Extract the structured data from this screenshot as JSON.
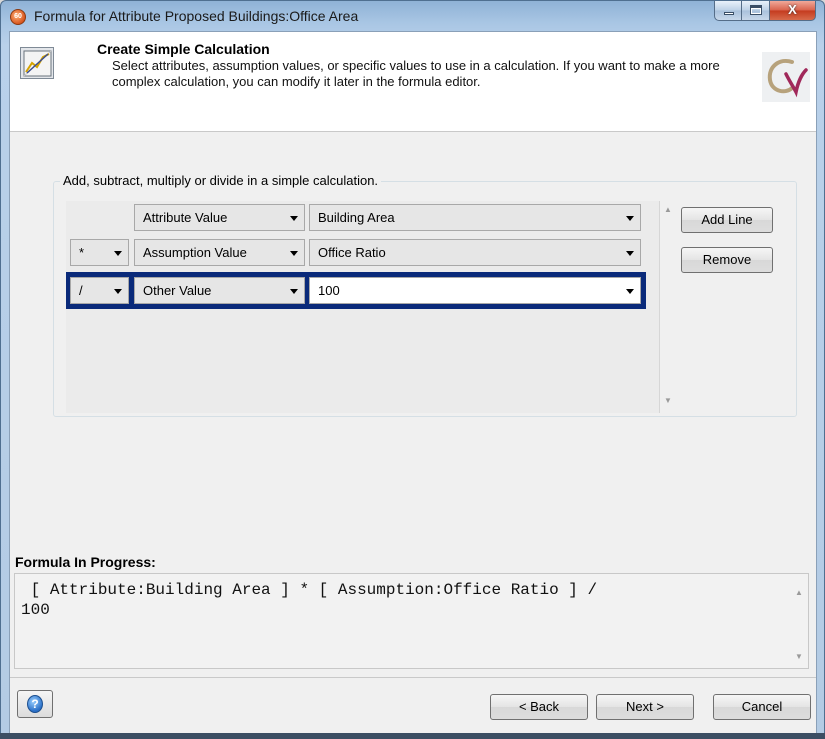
{
  "window": {
    "title": "Formula for Attribute Proposed Buildings:Office Area",
    "icon": "app-icon",
    "icon_text": "60",
    "caption": {
      "minimize": "minimize-icon",
      "maximize": "maximize-icon",
      "close_glyph": "X"
    }
  },
  "header": {
    "title": "Create Simple Calculation",
    "description": "Select attributes, assumption values, or specific values to use in a calculation.  If you want to make a more complex calculation, you can modify it later in the formula editor.",
    "icon": "chart-icon",
    "logo": "cv-logo"
  },
  "calc_group": {
    "label": "Add, subtract, multiply or divide in a simple calculation.",
    "rows": [
      {
        "operator": "",
        "type": "Attribute Value",
        "value": "Building Area",
        "selected": false
      },
      {
        "operator": "*",
        "type": "Assumption Value",
        "value": "Office Ratio",
        "selected": false
      },
      {
        "operator": "/",
        "type": "Other Value",
        "value": "100",
        "selected": true
      }
    ],
    "add_line_label": "Add Line",
    "remove_label": "Remove"
  },
  "formula": {
    "label": "Formula In Progress:",
    "text": " [ Attribute:Building Area ] * [ Assumption:Office Ratio ] /\n100"
  },
  "footer": {
    "help_icon": "help-icon",
    "back_label": "< Back",
    "next_label": "Next >",
    "cancel_label": "Cancel"
  },
  "colors": {
    "selection": "#0a2a7a",
    "title_bar": "#b9d1ea",
    "close_button": "#c43b1e"
  }
}
